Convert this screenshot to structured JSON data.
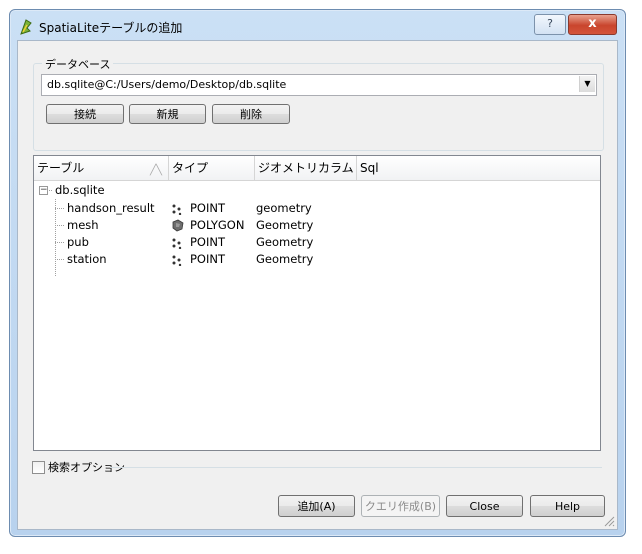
{
  "window": {
    "title": "SpatiaLiteテーブルの追加",
    "help_label": "?",
    "close_label": "x"
  },
  "database": {
    "group_label": "データベース",
    "selected": "db.sqlite@C:/Users/demo/Desktop/db.sqlite",
    "connect_label": "接続",
    "new_label": "新規",
    "delete_label": "削除"
  },
  "table": {
    "columns": [
      "テーブル",
      "タイプ",
      "ジオメトリカラム",
      "Sql"
    ],
    "root": "db.sqlite",
    "rows": [
      {
        "name": "handson_result",
        "icon": "point-icon",
        "type": "POINT",
        "geometry": "geometry"
      },
      {
        "name": "mesh",
        "icon": "polygon-icon",
        "type": "POLYGON",
        "geometry": "Geometry"
      },
      {
        "name": "pub",
        "icon": "point-icon",
        "type": "POINT",
        "geometry": "Geometry"
      },
      {
        "name": "station",
        "icon": "point-icon",
        "type": "POINT",
        "geometry": "Geometry"
      }
    ]
  },
  "search": {
    "label": "検索オプション",
    "checked": false
  },
  "footer": {
    "add_label": "追加(A)",
    "build_query_label": "クエリ作成(B)",
    "close_label": "Close",
    "help_label": "Help"
  }
}
